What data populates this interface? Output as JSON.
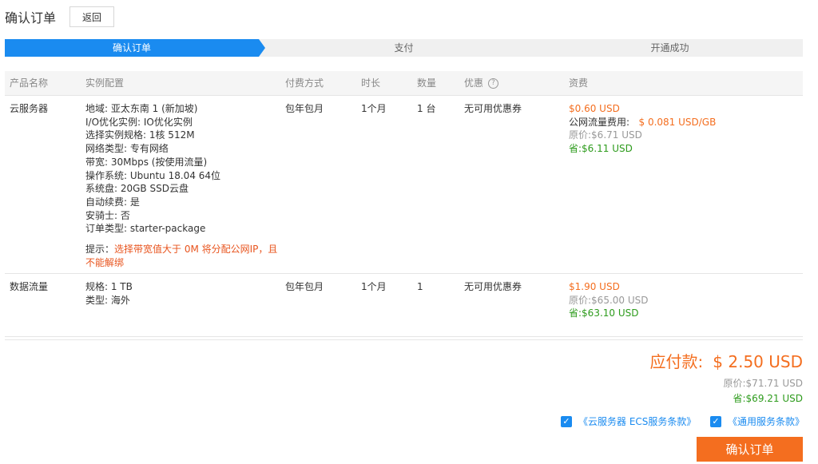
{
  "header": {
    "title": "确认订单",
    "back_label": "返回"
  },
  "steps": [
    "确认订单",
    "支付",
    "开通成功"
  ],
  "table": {
    "headers": {
      "name": "产品名称",
      "config": "实例配置",
      "pay": "付费方式",
      "duration": "时长",
      "qty": "数量",
      "discount": "优惠",
      "fee": "资费"
    },
    "rows": [
      {
        "name": "云服务器",
        "config": [
          "地域: 亚太东南 1 (新加坡)",
          "I/O优化实例: IO优化实例",
          "选择实例规格: 1核 512M",
          "网络类型: 专有网络",
          "带宽: 30Mbps (按使用流量)",
          "操作系统: Ubuntu 18.04 64位",
          "系统盘: 20GB SSD云盘",
          "自动续费: 是",
          "安骑士: 否",
          "订单类型: starter-package"
        ],
        "hint_label": "提示：",
        "hint_text": "选择带宽值大于 0M 将分配公网IP，且不能解绑",
        "pay": "包年包月",
        "duration": "1个月",
        "qty": "1 台",
        "discount": "无可用优惠券",
        "price": "$0.60 USD",
        "traffic_label": "公网流量费用:",
        "traffic_price": "$ 0.081 USD/GB",
        "original": "原价:$6.71 USD",
        "saved": "省:$6.11 USD"
      },
      {
        "name": "数据流量",
        "config": [
          "规格: 1 TB",
          "类型: 海外"
        ],
        "pay": "包年包月",
        "duration": "1个月",
        "qty": "1",
        "discount": "无可用优惠券",
        "price": "$1.90 USD",
        "original": "原价:$65.00 USD",
        "saved": "省:$63.10 USD"
      }
    ]
  },
  "summary": {
    "total_label": "应付款:",
    "total": "$ 2.50 USD",
    "original": "原价:$71.71 USD",
    "saved": "省:$69.21 USD"
  },
  "agreements": [
    "《云服务器 ECS服务条款》",
    "《通用服务条款》"
  ],
  "confirm_label": "确认订单",
  "colors": {
    "accent": "#1a8bf0",
    "orange": "#f46e1f",
    "green": "#2d9b1c"
  }
}
